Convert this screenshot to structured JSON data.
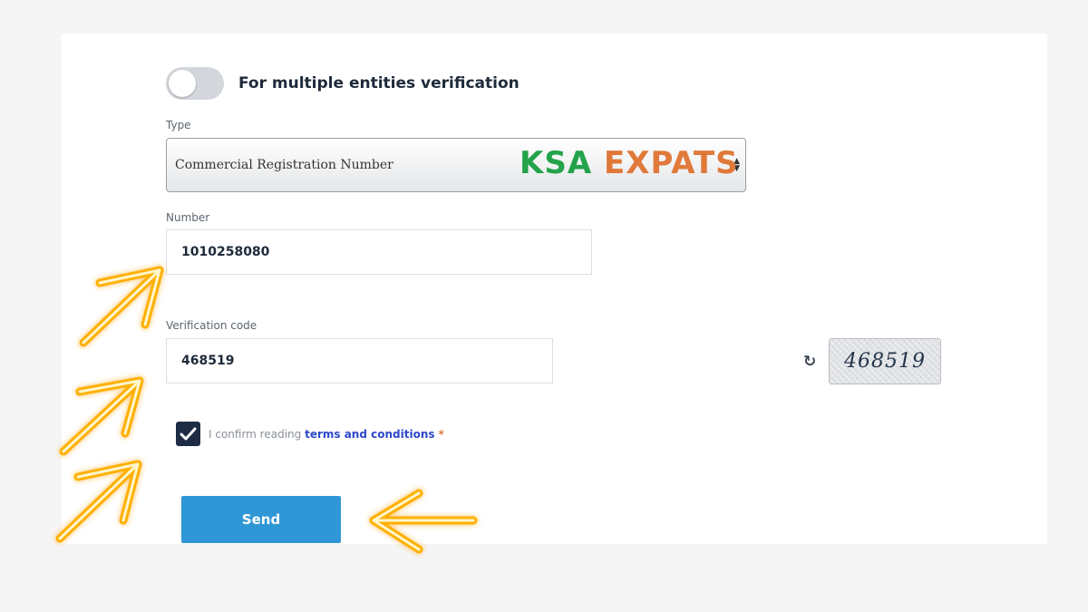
{
  "toggle": {
    "label": "For multiple entities verification",
    "on": false
  },
  "type_field": {
    "label": "Type",
    "selected": "Commercial Registration Number"
  },
  "watermark": {
    "part1": "KSA",
    "part2": "EXPATS"
  },
  "number_field": {
    "label": "Number",
    "value": "1010258080"
  },
  "verification": {
    "label": "Verification code",
    "value": "468519",
    "captcha_text": "468519"
  },
  "terms": {
    "prefix": "I confirm reading",
    "link": "terms and conditions",
    "required_mark": "*",
    "checked": true
  },
  "send_button": {
    "label": "Send"
  },
  "colors": {
    "primary": "#3097d6",
    "checkbox": "#1d2b45",
    "link": "#2c49c8",
    "annotation": "#ffb000"
  },
  "icons": {
    "refresh": "refresh-icon",
    "check": "check-icon",
    "select": "select-arrows-icon"
  }
}
